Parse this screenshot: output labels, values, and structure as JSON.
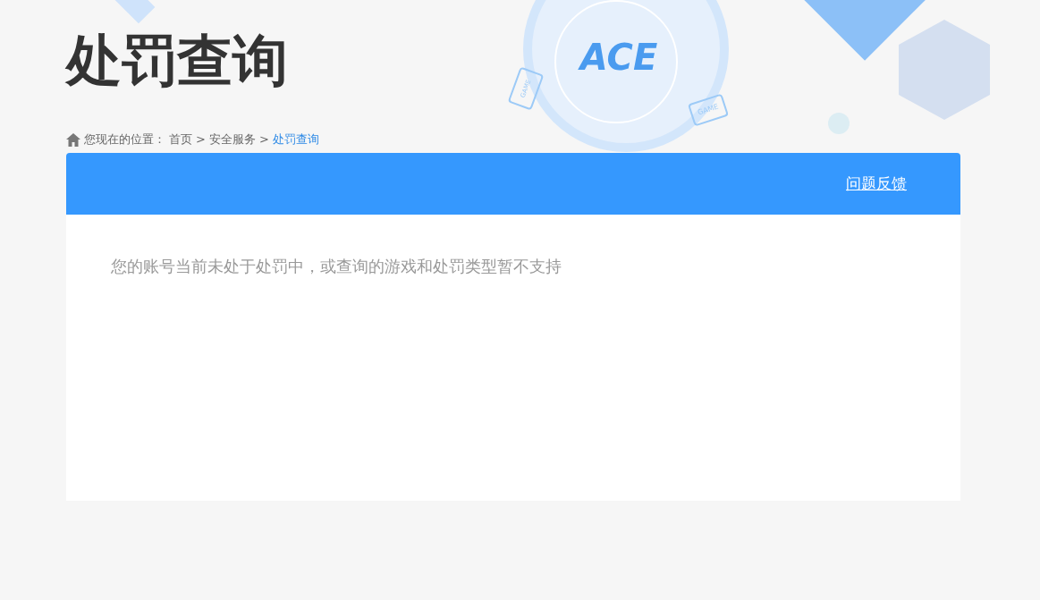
{
  "page_title": "处罚查询",
  "logo": {
    "text": "ACE"
  },
  "device_labels": [
    "GAME",
    "GAME"
  ],
  "breadcrumb": {
    "prefix": "您现在的位置：",
    "items": [
      {
        "label": "首页",
        "selected": false
      },
      {
        "label": "安全服务",
        "selected": false
      },
      {
        "label": "处罚查询",
        "selected": true
      }
    ],
    "separator": ">"
  },
  "panel": {
    "feedback_link": "问题反馈",
    "message": "您的账号当前未处于处罚中，或查询的游戏和处罚类型暂不支持"
  }
}
